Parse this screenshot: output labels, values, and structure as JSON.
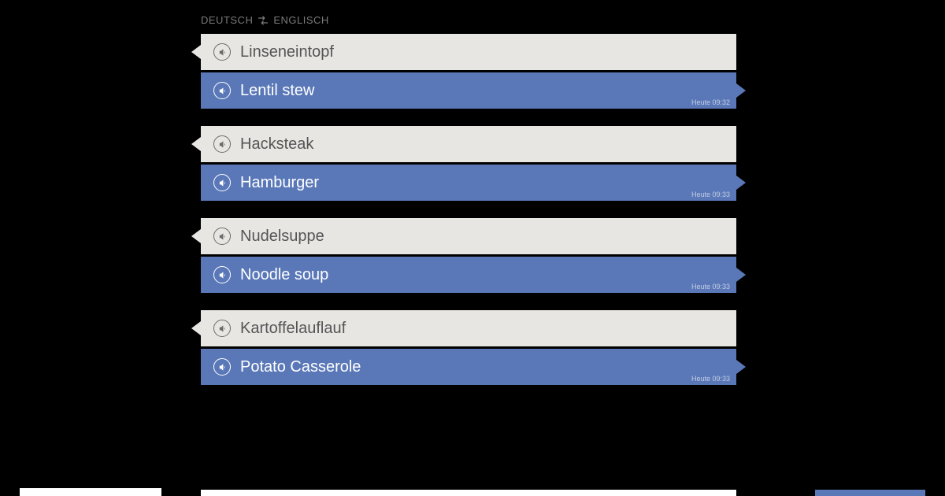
{
  "header": {
    "langFrom": "DEUTSCH",
    "langTo": "ENGLISCH"
  },
  "pairs": [
    {
      "source": "Linseneintopf",
      "target": "Lentil stew",
      "timestamp": "Heute 09:32"
    },
    {
      "source": "Hacksteak",
      "target": "Hamburger",
      "timestamp": "Heute 09:33"
    },
    {
      "source": "Nudelsuppe",
      "target": "Noodle soup",
      "timestamp": "Heute 09:33"
    },
    {
      "source": "Kartoffelauflauf",
      "target": "Potato Casserole",
      "timestamp": "Heute 09:33"
    }
  ]
}
